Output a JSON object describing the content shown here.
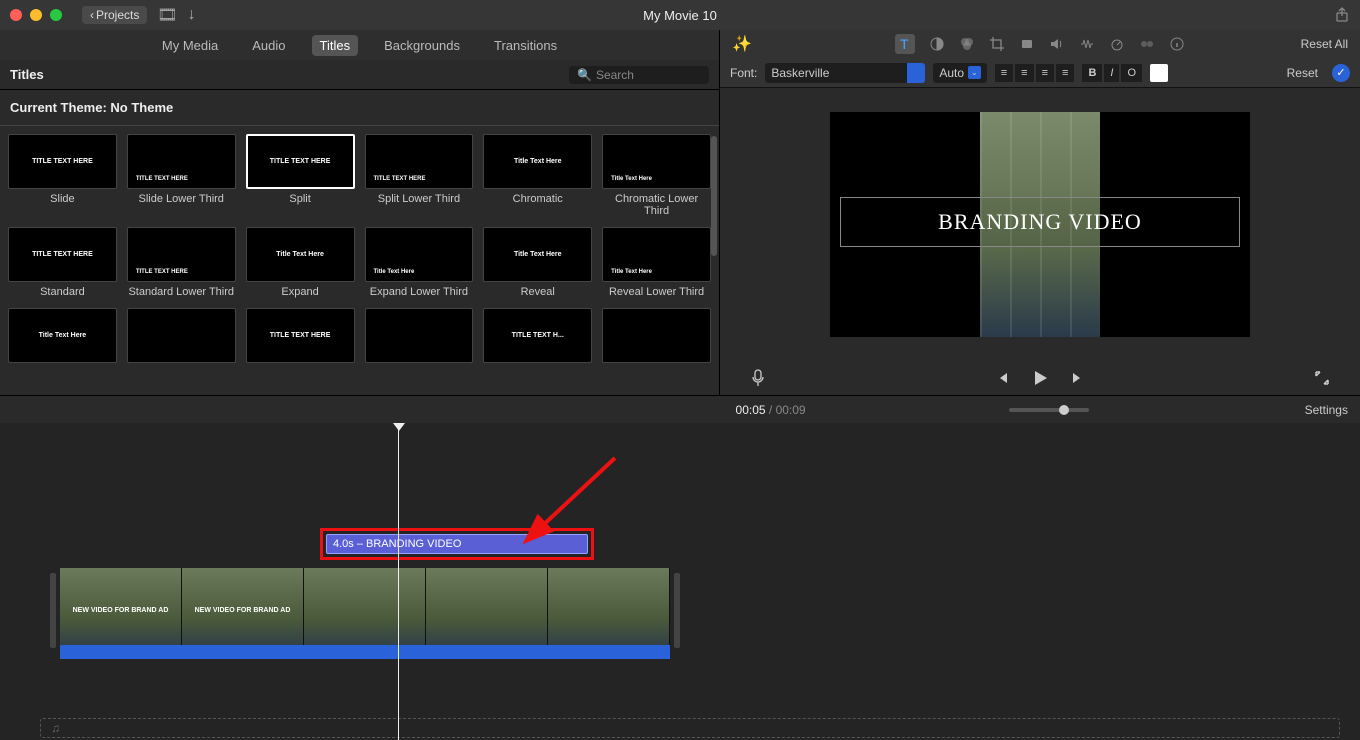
{
  "titlebar": {
    "back": "Projects",
    "title": "My Movie 10"
  },
  "tabs": {
    "items": [
      "My Media",
      "Audio",
      "Titles",
      "Backgrounds",
      "Transitions"
    ],
    "activeIndex": 2
  },
  "subheader": {
    "label": "Titles",
    "searchPlaceholder": "Search"
  },
  "theme": {
    "label": "Current Theme: No Theme"
  },
  "titles_grid": [
    {
      "name": "Slide",
      "preview": "TITLE TEXT HERE",
      "selected": false
    },
    {
      "name": "Slide Lower Third",
      "preview": "TITLE TEXT HERE",
      "lower": true
    },
    {
      "name": "Split",
      "preview": "TITLE TEXT HERE",
      "selected": true
    },
    {
      "name": "Split Lower Third",
      "preview": "TITLE TEXT HERE",
      "lower": true
    },
    {
      "name": "Chromatic",
      "preview": "Title Text Here"
    },
    {
      "name": "Chromatic Lower Third",
      "preview": "Title Text Here",
      "lower": true
    },
    {
      "name": "Standard",
      "preview": "TITLE TEXT HERE"
    },
    {
      "name": "Standard Lower Third",
      "preview": "TITLE TEXT HERE",
      "lower": true
    },
    {
      "name": "Expand",
      "preview": "Title Text Here"
    },
    {
      "name": "Expand Lower Third",
      "preview": "Title Text Here",
      "lower": true
    },
    {
      "name": "Reveal",
      "preview": "Title Text Here"
    },
    {
      "name": "Reveal Lower Third",
      "preview": "Title Text Here",
      "lower": true
    },
    {
      "name": "",
      "preview": "Title Text Here"
    },
    {
      "name": "",
      "preview": ""
    },
    {
      "name": "",
      "preview": "TITLE TEXT HERE"
    },
    {
      "name": "",
      "preview": ""
    },
    {
      "name": "",
      "preview": "TITLE TEXT H..."
    },
    {
      "name": "",
      "preview": ""
    }
  ],
  "viewer_tools": {
    "reset": "Reset All"
  },
  "font_row": {
    "label": "Font:",
    "font": "Baskerville",
    "size": "Auto",
    "bold": "B",
    "italic": "I",
    "outline": "O",
    "reset": "Reset",
    "swatch": "#ffffff"
  },
  "preview": {
    "title_text": "BRANDING VIDEO"
  },
  "timeline_header": {
    "current": "00:05",
    "sep": " / ",
    "total": "00:09",
    "settings": "Settings"
  },
  "title_clip": {
    "label": "4.0s – BRANDING VIDEO"
  },
  "clip_overlay_text": "NEW VIDEO FOR BRAND AD",
  "audio_icon": "♫"
}
